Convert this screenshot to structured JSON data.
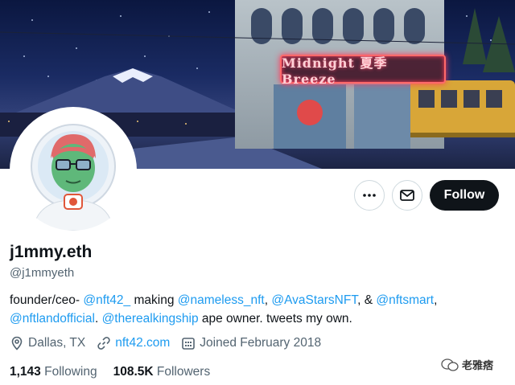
{
  "banner": {
    "sign_text": "Midnight 夏季 Breeze"
  },
  "actions": {
    "more_label": "More",
    "message_label": "Message",
    "follow_label": "Follow"
  },
  "profile": {
    "display_name": "j1mmy.eth",
    "handle": "@j1mmyeth",
    "bio": {
      "t1": "founder/ceo- ",
      "m1": "@nft42_",
      "t2": " making ",
      "m2": "@nameless_nft",
      "t3": ", ",
      "m3": "@AvaStarsNFT",
      "t4": ", & ",
      "m4": "@nftsmart",
      "t5": ",",
      "m5": "@nftlandofficial",
      "t6": ". ",
      "m6": "@therealkingship",
      "t7": " ape owner. tweets my own."
    },
    "location": "Dallas, TX",
    "website": "nft42.com",
    "joined": "Joined February 2018",
    "following_count": "1,143",
    "following_label": "Following",
    "followers_count": "108.5K",
    "followers_label": "Followers"
  },
  "watermark": {
    "text": "老雅痞"
  },
  "colors": {
    "link": "#1d9bf0",
    "muted": "#536471",
    "follow_bg": "#0f1419"
  }
}
